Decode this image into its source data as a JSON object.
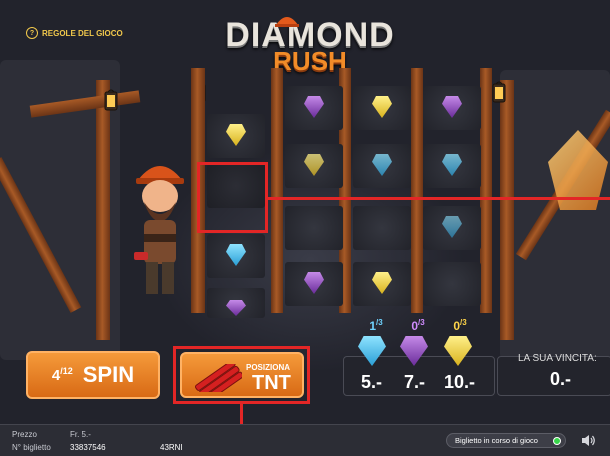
{
  "header": {
    "help_label": "REGOLE DEL GIOCO",
    "title_line1": "DIAMOND",
    "title_line2": "RUSH"
  },
  "controls": {
    "spin_count": "4",
    "spin_total": "12",
    "spin_label": "SPIN",
    "tnt_small": "POSIZIONA",
    "tnt_big": "TNT"
  },
  "gem_counters": [
    {
      "color": "blue",
      "count": "1",
      "total": "3",
      "prize": "5.-"
    },
    {
      "color": "purple",
      "count": "0",
      "total": "3",
      "prize": "7.-"
    },
    {
      "color": "yellow",
      "count": "0",
      "total": "3",
      "prize": "10.-"
    }
  ],
  "win": {
    "label": "LA SUA VINCITA:",
    "value": "0.-"
  },
  "footer": {
    "price_label": "Prezzo",
    "price_value": "Fr. 5.-",
    "ticket_label": "N° biglietto",
    "ticket_number": "33837546",
    "ticket_code": "43RNI",
    "status": "Biglietto in corso di gioco"
  },
  "colors": {
    "accent_orange": "#f28c28",
    "highlight_red": "#e32626",
    "gem_blue": "#2a9fd6",
    "gem_purple": "#6a2c9a",
    "gem_yellow": "#d8b21d"
  }
}
